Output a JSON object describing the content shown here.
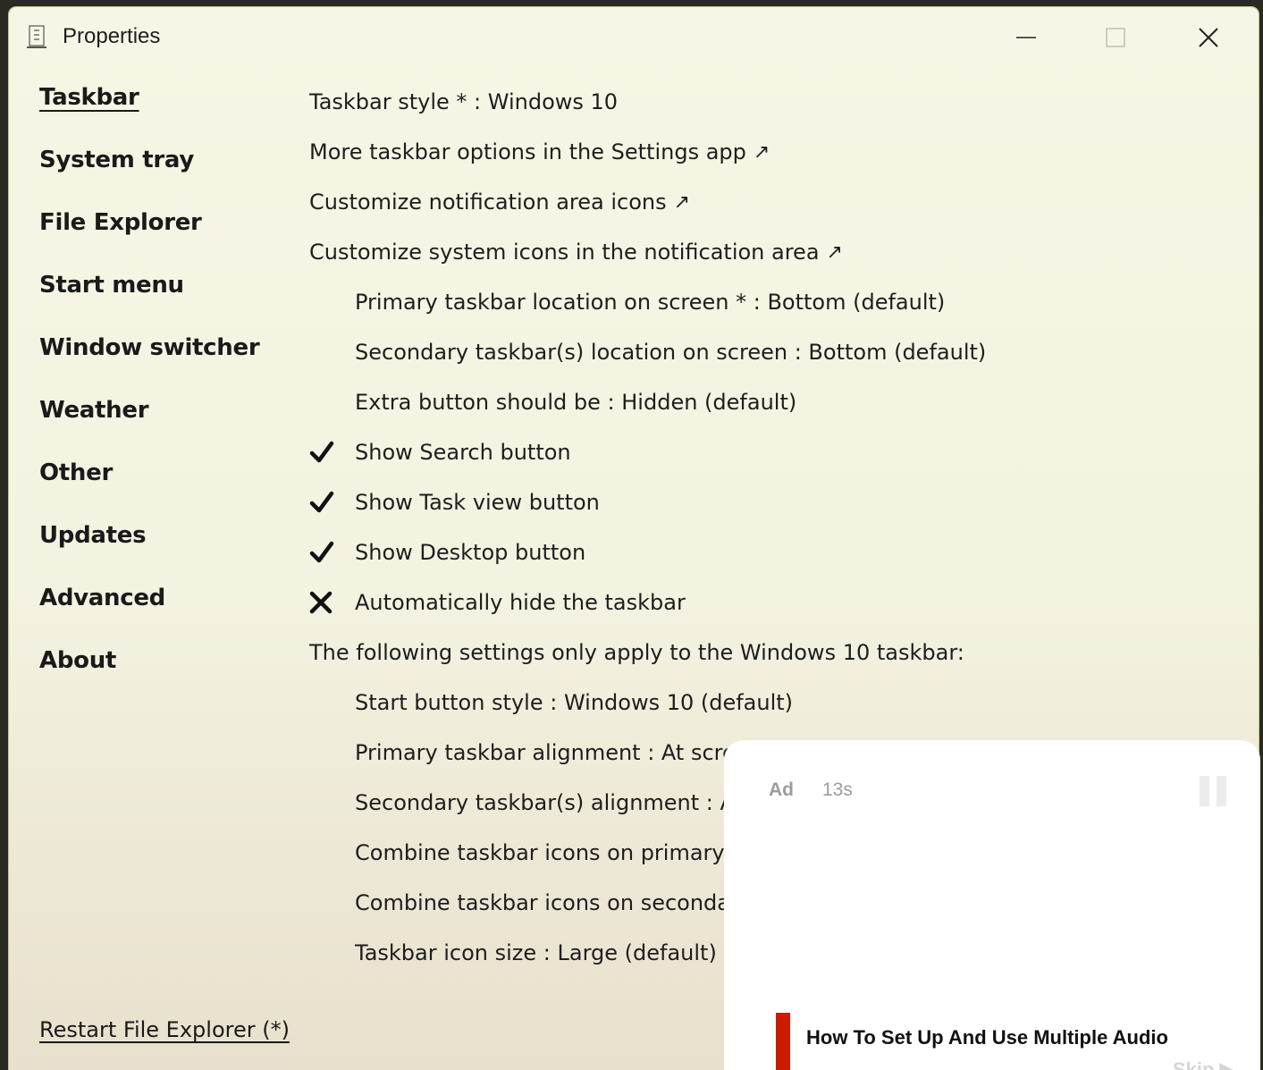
{
  "window": {
    "title": "Properties",
    "controls": {
      "minimize_icon": "minimize-icon",
      "maximize_icon": "maximize-icon",
      "close_icon": "close-icon"
    }
  },
  "sidebar": {
    "items": [
      {
        "label": "Taskbar",
        "active": true
      },
      {
        "label": "System tray"
      },
      {
        "label": "File Explorer"
      },
      {
        "label": "Start menu"
      },
      {
        "label": "Window switcher"
      },
      {
        "label": "Weather"
      },
      {
        "label": "Other"
      },
      {
        "label": "Updates"
      },
      {
        "label": "Advanced"
      },
      {
        "label": "About"
      }
    ],
    "footer_link": "Restart File Explorer (*)"
  },
  "settings": {
    "taskbar_style": "Taskbar style * : Windows 10",
    "more_options": "More taskbar options in the Settings app",
    "customize_notification_icons": "Customize notification area icons",
    "customize_system_icons": "Customize system icons in the notification area",
    "external_arrow": "↗",
    "primary_location": "Primary taskbar location on screen * : Bottom (default)",
    "secondary_location": "Secondary taskbar(s) location on screen : Bottom (default)",
    "extra_button": "Extra button should be : Hidden (default)",
    "show_search": {
      "label": "Show Search button",
      "checked": true
    },
    "show_task_view": {
      "label": "Show Task view button",
      "checked": true
    },
    "show_desktop": {
      "label": "Show Desktop button",
      "checked": true
    },
    "auto_hide": {
      "label": "Automatically hide the taskbar",
      "checked": false
    },
    "win10_note": "The following settings only apply to the Windows 10 taskbar:",
    "start_button_style": "Start button style : Windows 10 (default)",
    "primary_alignment": "Primary taskbar alignment : At screen edge (default)",
    "secondary_alignment": "Secondary taskbar(s) alignment : At",
    "combine_primary": "Combine taskbar icons on primary t",
    "combine_secondary": "Combine taskbar icons on secondar",
    "icon_size": "Taskbar icon size : Large (default)"
  },
  "ad": {
    "label": "Ad",
    "timer": "13s",
    "title": "How To Set Up And Use Multiple Audio",
    "skip": "Skip ▶",
    "accent_color": "#cc1b00"
  }
}
